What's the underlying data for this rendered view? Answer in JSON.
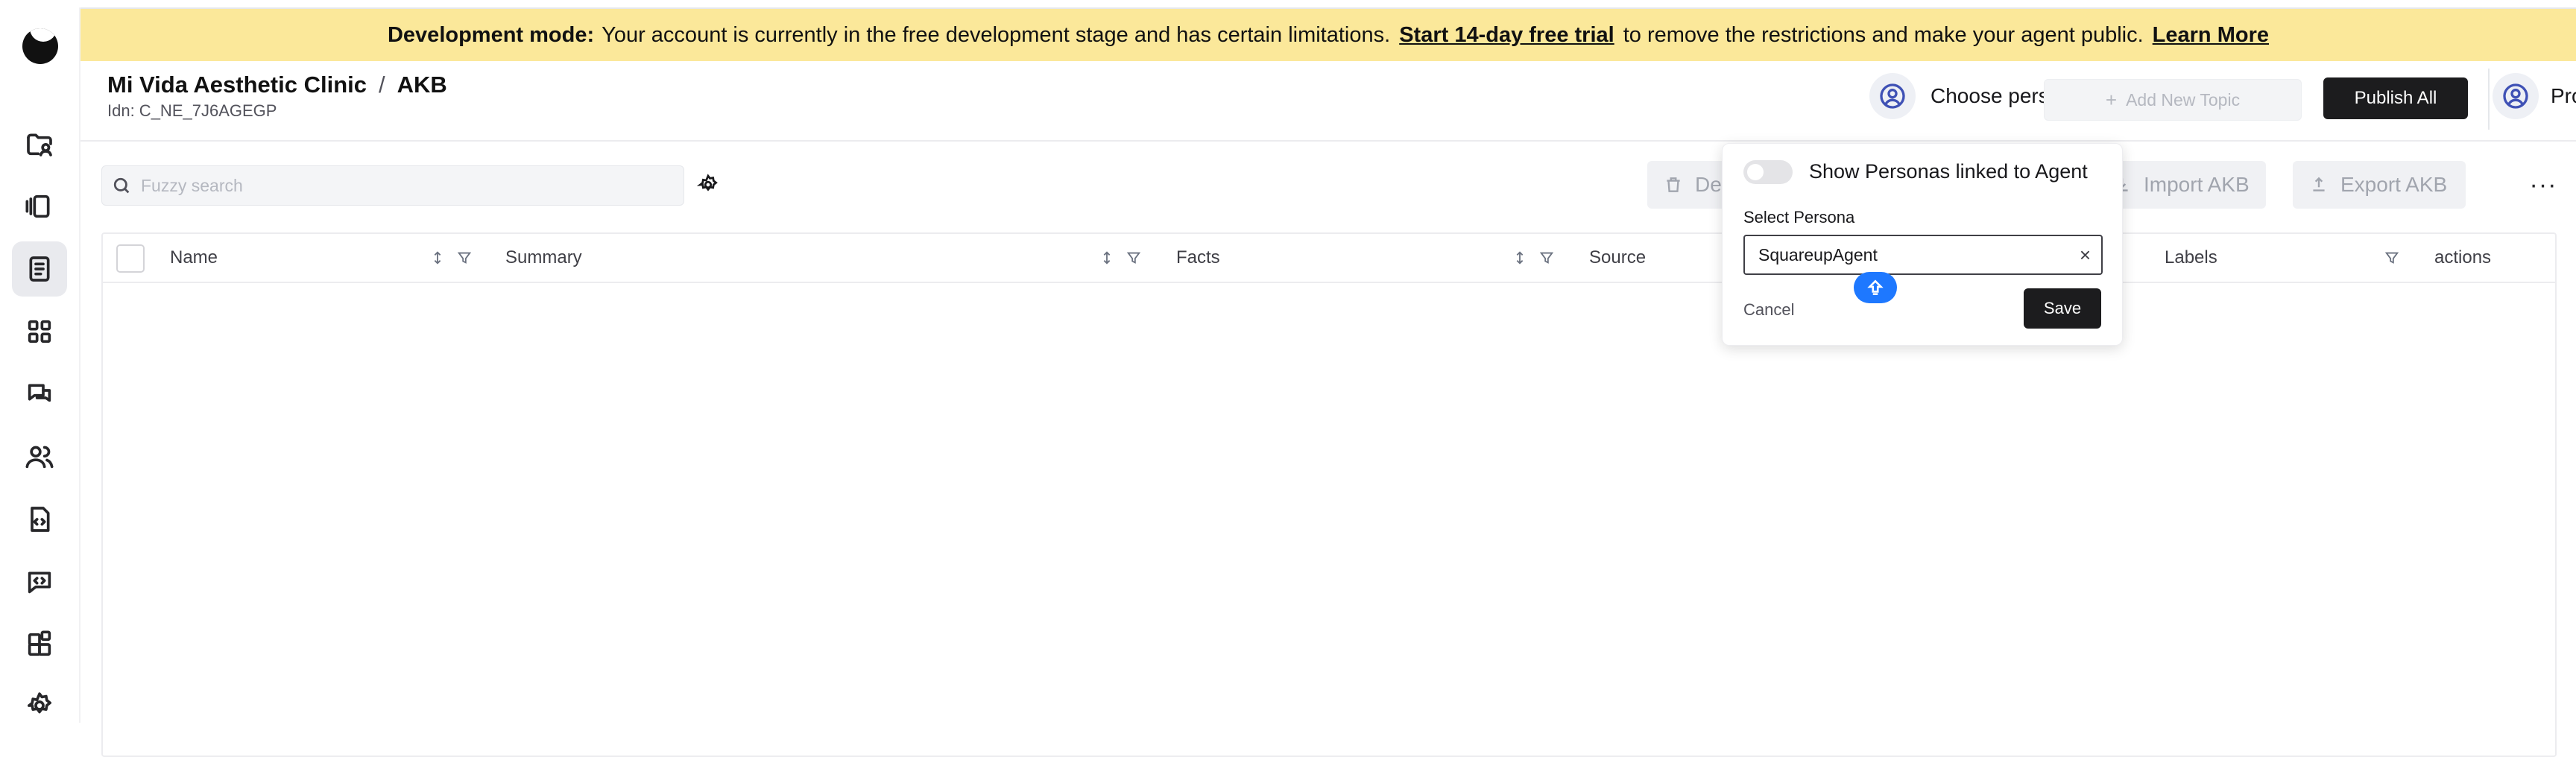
{
  "banner": {
    "mode_label": "Development mode:",
    "message": "Your account is currently in the free development stage and has certain limitations.",
    "trial_link": "Start 14-day free trial",
    "message_end": "to remove the restrictions and make your agent public.",
    "learn_more": "Learn More",
    "background_color": "#fbe89a"
  },
  "header": {
    "org": "Mi Vida Aesthetic Clinic",
    "separator": "/",
    "section": "AKB",
    "idn": "Idn: C_NE_7J6AGEGP",
    "choose_person": "Choose person",
    "add_topic": "Add New Topic",
    "publish_all": "Publish All",
    "profile": "Profile"
  },
  "sidebar": {
    "icons": [
      "folder-user-icon",
      "carousel-icon",
      "document-icon",
      "grid-icon",
      "chat-icon",
      "users-icon",
      "file-code-icon",
      "code-message-icon",
      "widgets-icon",
      "settings-icon"
    ],
    "active_index": 2
  },
  "toolbar": {
    "search_placeholder": "Fuzzy search",
    "delete_label": "De",
    "import_label": "Import AKB",
    "export_label": "Export AKB",
    "more": "···"
  },
  "table": {
    "columns": [
      "Name",
      "Summary",
      "Facts",
      "Source",
      "Labels",
      "actions"
    ],
    "rows": []
  },
  "popover": {
    "toggle_label": "Show Personas linked to Agent",
    "toggle_on": false,
    "select_label": "Select Persona",
    "selected_value": "SquareupAgent",
    "clear": "×",
    "cancel": "Cancel",
    "save": "Save"
  }
}
